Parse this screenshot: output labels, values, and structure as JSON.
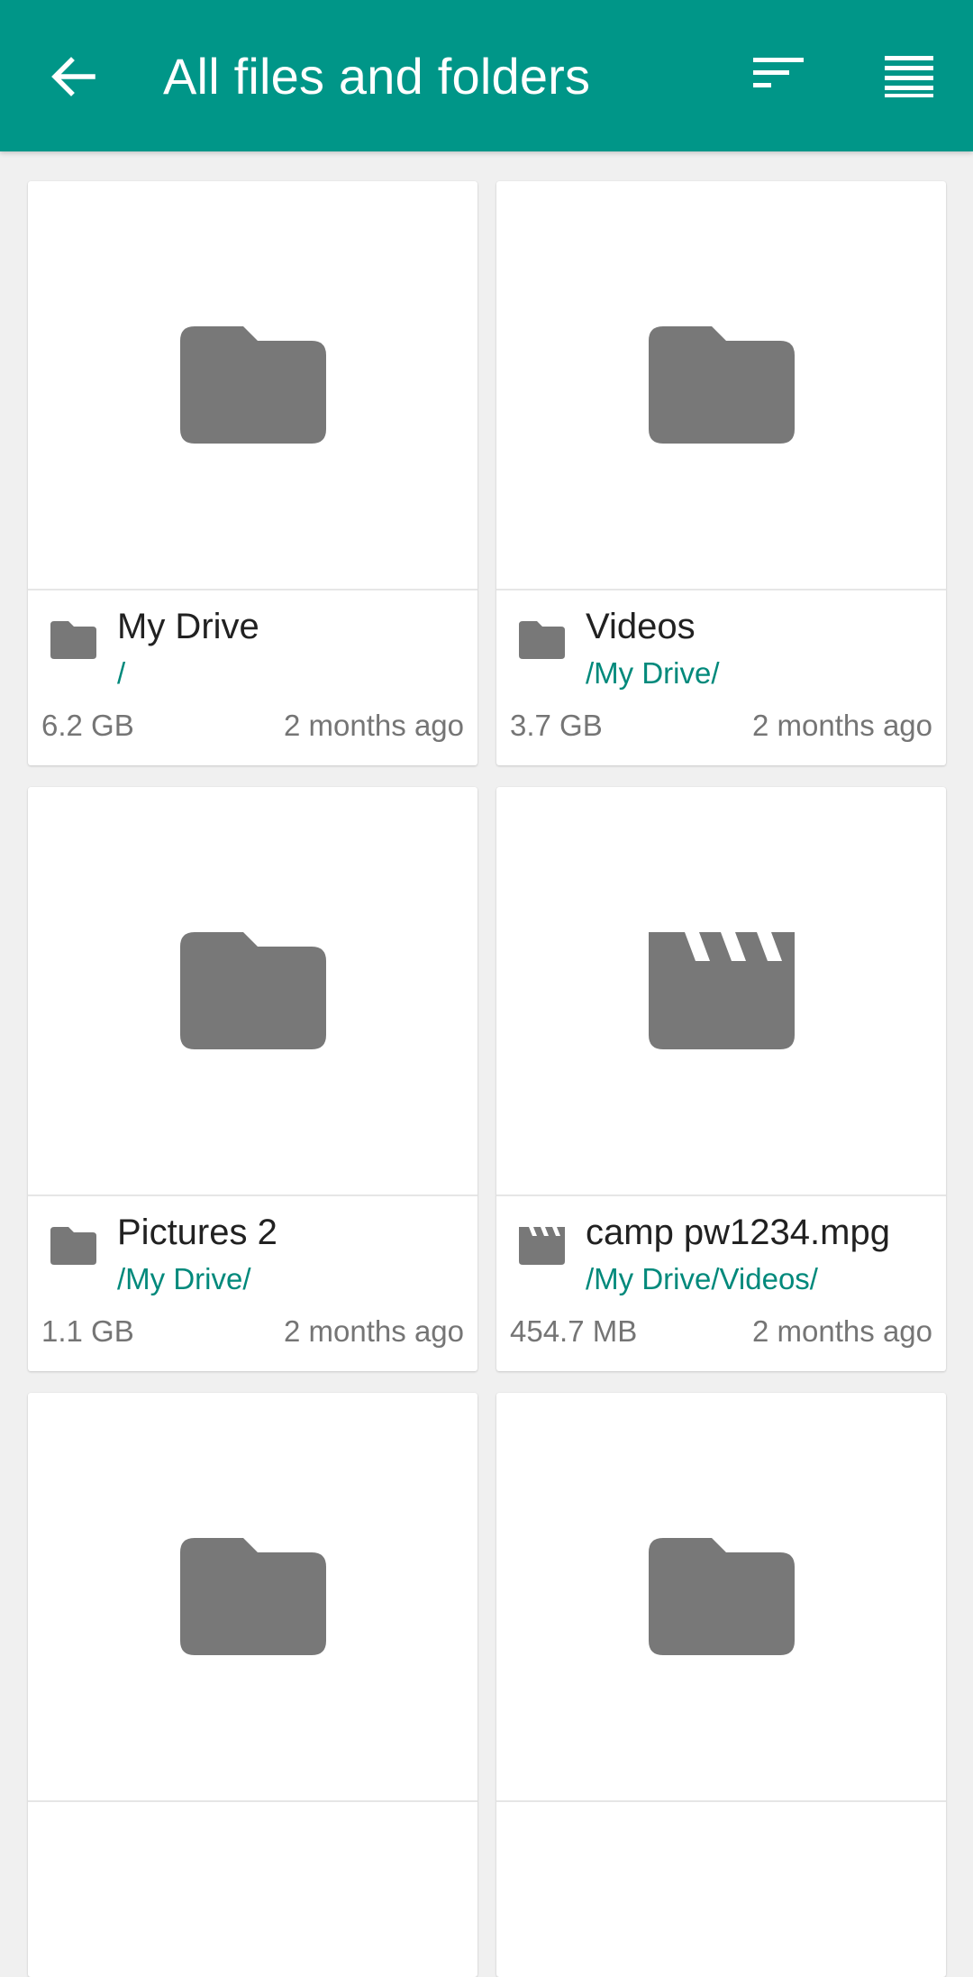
{
  "appbar": {
    "title": "All files and folders",
    "back_icon": "arrow-back-icon",
    "sort_icon": "sort-icon",
    "view_icon": "view-list-icon",
    "background_color": "#009688"
  },
  "colors": {
    "icon_gray": "#787878",
    "path_teal": "#00897b",
    "meta_gray": "#757575"
  },
  "items": [
    {
      "name": "My Drive",
      "path": "/",
      "size": "6.2 GB",
      "modified": "2 months ago",
      "type": "folder"
    },
    {
      "name": "Videos",
      "path": "/My Drive/",
      "size": "3.7 GB",
      "modified": "2 months ago",
      "type": "folder"
    },
    {
      "name": "Pictures 2",
      "path": "/My Drive/",
      "size": "1.1 GB",
      "modified": "2 months ago",
      "type": "folder"
    },
    {
      "name": "camp pw1234.mpg",
      "path": "/My Drive/Videos/",
      "size": "454.7 MB",
      "modified": "2 months ago",
      "type": "video"
    },
    {
      "type": "folder"
    },
    {
      "type": "folder"
    }
  ]
}
